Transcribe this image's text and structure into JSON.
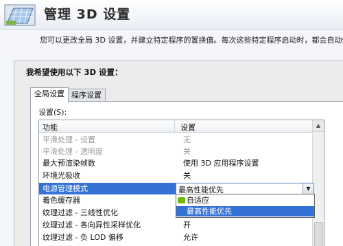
{
  "header": {
    "title": "管理 3D 设置"
  },
  "description": "您可以更改全局 3D 设置，并建立特定程序的置换值。每次这些特定程序启动时，都会自动使用",
  "section_label": "我希望使用以下 3D 设置：",
  "tabs": [
    {
      "label": "全局设置",
      "active": true
    },
    {
      "label": "程序设置",
      "active": false
    }
  ],
  "settings_label": "设置(S):",
  "grid": {
    "col_feature": "功能",
    "col_setting": "设置",
    "rows": [
      {
        "feature": "平滑处理 - 设置",
        "value": "无",
        "state": "disabled"
      },
      {
        "feature": "平滑处理 - 透明度",
        "value": "关",
        "state": "disabled"
      },
      {
        "feature": "最大预渲染帧数",
        "value": "使用 3D 应用程序设置",
        "state": "normal"
      },
      {
        "feature": "环境光吸收",
        "value": "关",
        "state": "normal"
      },
      {
        "feature": "电源管理模式",
        "value": "",
        "state": "selected"
      },
      {
        "feature": "着色缓存器",
        "value": "",
        "state": "normal"
      },
      {
        "feature": "纹理过滤 - 三线性优化",
        "value": "",
        "state": "normal"
      },
      {
        "feature": "纹理过滤 - 各向异性采样优化",
        "value": "开",
        "state": "normal"
      },
      {
        "feature": "纹理过滤 - 负 LOD 偏移",
        "value": "允许",
        "state": "normal"
      }
    ]
  },
  "combo": {
    "selected": "最高性能优先",
    "options": [
      {
        "label": "自适应",
        "icon": "nvidia-icon",
        "selected": false
      },
      {
        "label": "最高性能优先",
        "icon": "",
        "selected": true
      }
    ]
  },
  "colors": {
    "selection": "#3473d5",
    "nvidia_green": "#76b900"
  }
}
